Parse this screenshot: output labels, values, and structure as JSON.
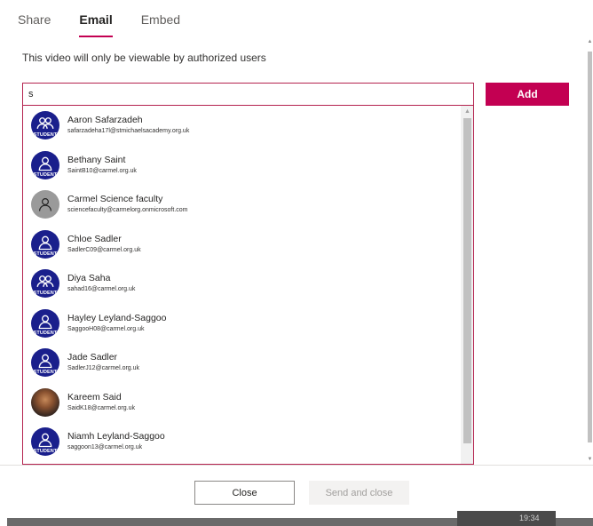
{
  "tabs": [
    {
      "label": "Share",
      "active": false
    },
    {
      "label": "Email",
      "active": true
    },
    {
      "label": "Embed",
      "active": false
    }
  ],
  "info_text": "This video will only be viewable by authorized users",
  "search": {
    "value": "s",
    "placeholder": ""
  },
  "add_label": "Add",
  "avatar_tag": "STUDENT",
  "people": [
    {
      "name": "Aaron Safarzadeh",
      "email": "safarzadeha17l@stmichaelsacademy.org.uk",
      "avatar": "students-group-icon"
    },
    {
      "name": "Bethany Saint",
      "email": "SaintB10@carmel.org.uk",
      "avatar": "student-icon"
    },
    {
      "name": "Carmel Science faculty",
      "email": "sciencefaculty@carmelorg.onmicrosoft.com",
      "avatar": "person-icon"
    },
    {
      "name": "Chloe Sadler",
      "email": "SadlerC09@carmel.org.uk",
      "avatar": "student-icon"
    },
    {
      "name": "Diya Saha",
      "email": "sahad16@carmel.org.uk",
      "avatar": "students-group-icon"
    },
    {
      "name": "Hayley Leyland-Saggoo",
      "email": "SaggooH08@carmel.org.uk",
      "avatar": "student-icon"
    },
    {
      "name": "Jade Sadler",
      "email": "SadlerJ12@carmel.org.uk",
      "avatar": "student-icon"
    },
    {
      "name": "Kareem Said",
      "email": "SaidK18@carmel.org.uk",
      "avatar": "photo"
    },
    {
      "name": "Niamh Leyland-Saggoo",
      "email": "saggoon13@carmel.org.uk",
      "avatar": "student-icon"
    }
  ],
  "close_label": "Close",
  "send_label": "Send and close",
  "timestamp": "19:34",
  "colors": {
    "accent": "#c30052",
    "avatar_bg": "#1a1f8c",
    "avatar_gray": "#9a9a9a"
  }
}
